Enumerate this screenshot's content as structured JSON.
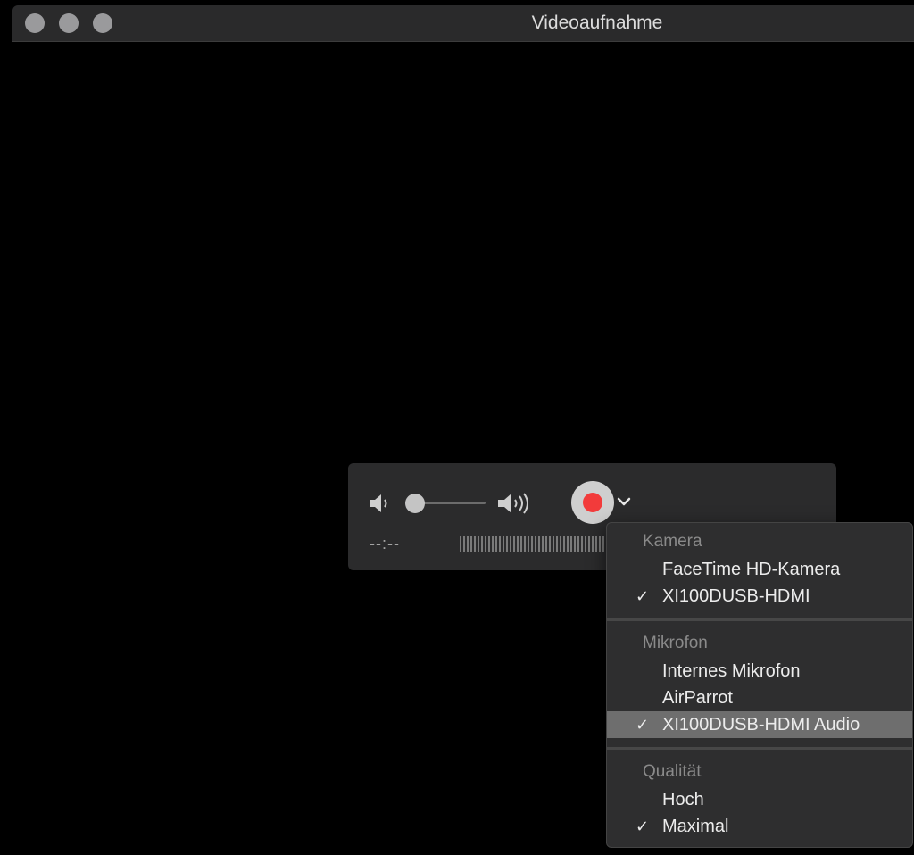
{
  "window": {
    "title": "Videoaufnahme"
  },
  "controls": {
    "time": "--:--",
    "volume": 0.0,
    "record_color": "#f23b3b"
  },
  "menu": {
    "camera": {
      "header": "Kamera",
      "items": [
        {
          "label": "FaceTime HD-Kamera",
          "checked": false
        },
        {
          "label": "XI100DUSB-HDMI",
          "checked": true
        }
      ]
    },
    "microphone": {
      "header": "Mikrofon",
      "items": [
        {
          "label": "Internes Mikrofon",
          "checked": false
        },
        {
          "label": "AirParrot",
          "checked": false
        },
        {
          "label": "XI100DUSB-HDMI Audio",
          "checked": true
        }
      ]
    },
    "quality": {
      "header": "Qualität",
      "items": [
        {
          "label": "Hoch",
          "checked": false
        },
        {
          "label": "Maximal",
          "checked": true
        }
      ]
    },
    "check_mark": "✓"
  }
}
